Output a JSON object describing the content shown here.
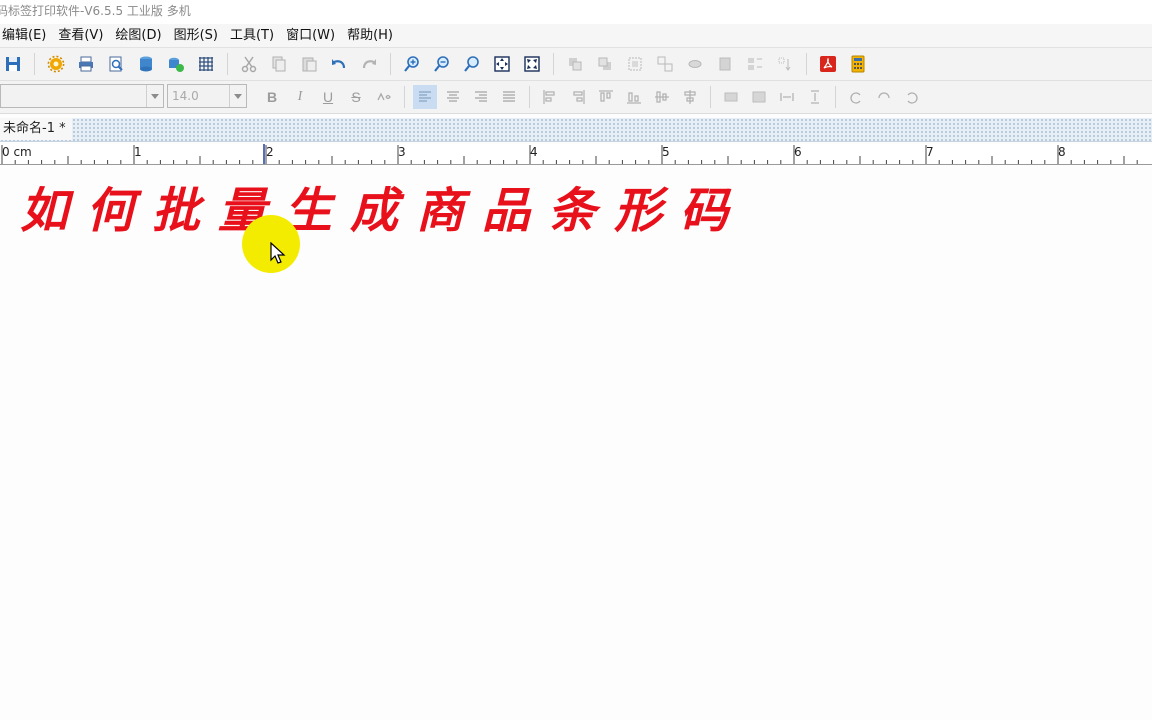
{
  "window": {
    "title": "码标签打印软件-V6.5.5 工业版 多机"
  },
  "menu": [
    "编辑(E)",
    "查看(V)",
    "绘图(D)",
    "图形(S)",
    "工具(T)",
    "窗口(W)",
    "帮助(H)"
  ],
  "font": {
    "size": "14.0"
  },
  "document": {
    "tab_label": "未命名-1 *"
  },
  "ruler": {
    "labels": [
      "0 cm",
      "1",
      "2",
      "3",
      "4",
      "5",
      "6",
      "7",
      "8"
    ]
  },
  "canvas": {
    "headline": "如何批量生成商品条形码",
    "headline_color": "#e8101a"
  },
  "colors": {
    "highlight": "#f4ec00",
    "active_button": "#c9dcf1"
  }
}
